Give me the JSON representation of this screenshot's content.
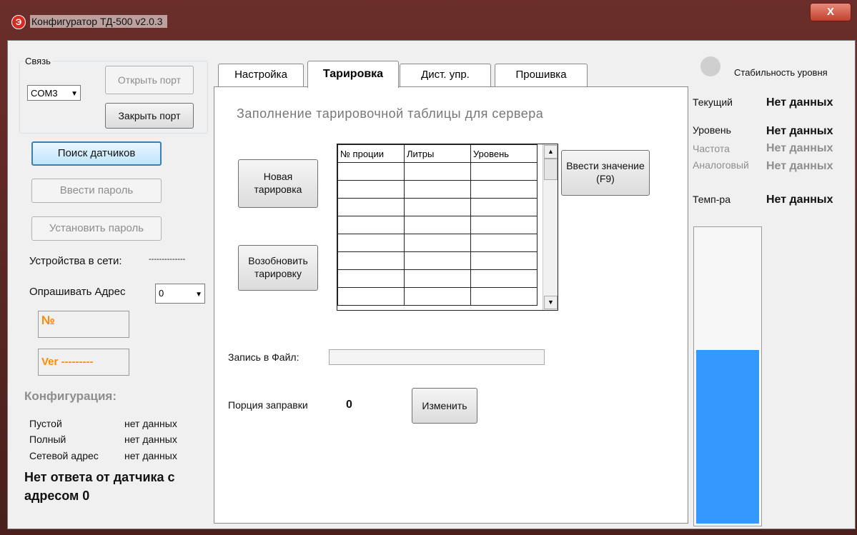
{
  "window": {
    "title": "Конфигуратор ТД-500 v2.0.3",
    "close_label": "X",
    "icon_letter": "Э"
  },
  "connection": {
    "group_label": "Связь",
    "port_value": "COM3",
    "open_port": "Открыть порт",
    "close_port": "Закрыть порт"
  },
  "left": {
    "search_sensors": "Поиск датчиков",
    "enter_password": "Ввести пароль",
    "set_password": "Установить пароль",
    "devices_label": "Устройства в сети:",
    "devices_value": "--------------",
    "poll_label": "Опрашивать Адрес",
    "poll_value": "0",
    "number_label": "№",
    "ver_label": "Ver ---------",
    "config_title": "Конфигурация:",
    "config_rows": [
      {
        "label": "Пустой",
        "value": "нет данных"
      },
      {
        "label": "Полный",
        "value": "нет данных"
      },
      {
        "label": "Сетевой адрес",
        "value": "нет данных"
      }
    ],
    "no_response": "Нет ответа от датчика с адресом 0"
  },
  "tabs": [
    "Настройка",
    "Тарировка",
    "Дист. упр.",
    "Прошивка"
  ],
  "active_tab": "Тарировка",
  "calibration": {
    "heading": "Заполнение тарировочной таблицы для сервера",
    "new_calibration": "Новая тарировка",
    "resume_calibration": "Возобновить тарировку",
    "enter_value": "Ввести значение (F9)",
    "columns": [
      "№ проции",
      "Литры",
      "Уровень"
    ],
    "row_count": 8,
    "write_file_label": "Запись в  Файл:",
    "write_file_value": "",
    "portion_label": "Порция заправки",
    "portion_value": "0",
    "change_button": "Изменить"
  },
  "status": {
    "stability_label": "Стабильность уровня",
    "rows": [
      {
        "label": "Текущий",
        "value": "Нет данных",
        "muted": false
      },
      {
        "label": "Уровень",
        "value": "Нет данных",
        "muted": false
      },
      {
        "label": "Частота",
        "value": "Нет данных",
        "muted": true
      },
      {
        "label": "Аналоговый",
        "value": "Нет данных",
        "muted": true
      },
      {
        "label": "Темп-ра",
        "value": "Нет данных",
        "muted": false
      }
    ],
    "level_fill_fraction": 0.59,
    "level_color": "#3399ff"
  }
}
